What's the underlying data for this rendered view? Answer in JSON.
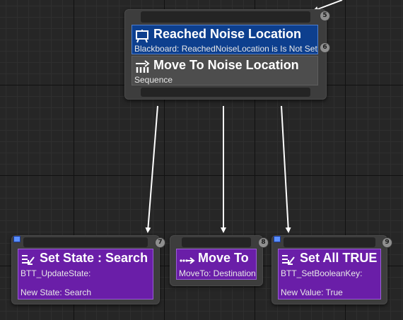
{
  "colors": {
    "decorator_bg": "#0d3f8e",
    "task_bg": "#6a1ea8",
    "composite_bg": "#4d4d4d",
    "wire": "#ffffff"
  },
  "sequence_node": {
    "badge": "5",
    "decorator": {
      "title": "Reached Noise Location",
      "subtitle": "Blackboard: ReachedNoiseLocation is Is Not Set",
      "badge": "6",
      "icon": "blackboard-decorator-icon"
    },
    "composite": {
      "title": "Move To Noise Location",
      "subtitle": "Sequence",
      "icon": "sequence-icon"
    }
  },
  "tasks": [
    {
      "title": "Set State : Search",
      "line1": "BTT_UpdateState:",
      "line2": "New State: Search",
      "badge": "7",
      "icon": "blueprint-task-icon"
    },
    {
      "title": "Move To",
      "line1": "MoveTo: Destination",
      "badge": "8",
      "icon": "move-to-icon"
    },
    {
      "title": "Set All TRUE",
      "line1": "BTT_SetBooleanKey:",
      "line2": "New Value: True",
      "badge": "9",
      "icon": "blueprint-task-icon"
    }
  ]
}
